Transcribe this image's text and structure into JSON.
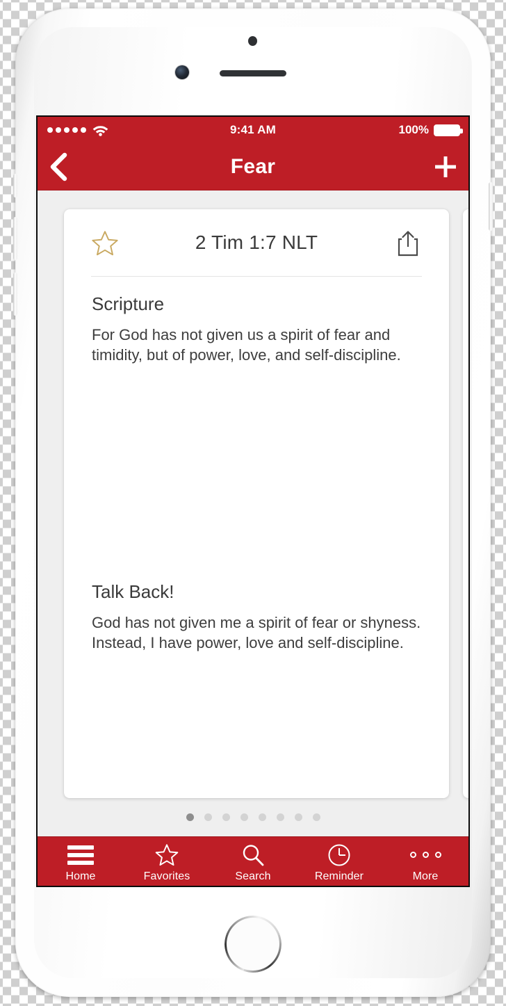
{
  "colors": {
    "brand_red": "#BE1E26",
    "screen_background": "#EFEFEF",
    "card_background": "#FFFFFF",
    "star_gold": "#C9A961",
    "text_primary": "#3A3A3A",
    "dot_active": "#8E8E8E",
    "dot_inactive": "#D3D3D3"
  },
  "status_bar": {
    "signal_dots": 5,
    "signal_icon": "signal-dots-icon",
    "wifi_icon": "wifi-icon",
    "time": "9:41 AM",
    "battery_percent": "100%",
    "battery_icon": "battery-full-icon"
  },
  "nav_bar": {
    "back_icon": "chevron-left-icon",
    "title": "Fear",
    "add_icon": "plus-icon"
  },
  "card": {
    "favorite_icon": "star-outline-icon",
    "reference": "2 Tim 1:7 NLT",
    "share_icon": "share-icon",
    "sections": [
      {
        "heading": "Scripture",
        "body": "For God has not given us a spirit of fear and timidity, but of power, love, and self-discipline."
      },
      {
        "heading": "Talk Back!",
        "body": "God has not given me a spirit of fear or shyness. Instead, I have power, love and self-discipline."
      }
    ]
  },
  "pagination": {
    "total": 8,
    "active_index": 0
  },
  "tab_bar": {
    "items": [
      {
        "label": "Home",
        "icon": "hamburger-menu-icon"
      },
      {
        "label": "Favorites",
        "icon": "star-outline-icon"
      },
      {
        "label": "Search",
        "icon": "magnifier-icon"
      },
      {
        "label": "Reminder",
        "icon": "clock-icon"
      },
      {
        "label": "More",
        "icon": "ellipsis-icon"
      }
    ]
  }
}
